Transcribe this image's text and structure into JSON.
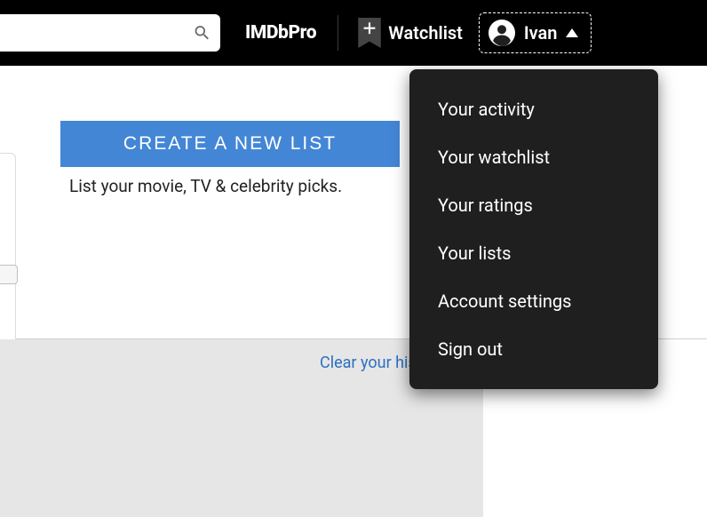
{
  "topbar": {
    "pro_label": "IMDbPro",
    "watchlist_label": "Watchlist",
    "user_name": "Ivan",
    "search_placeholder": ""
  },
  "content": {
    "create_button_label": "CREATE A NEW LIST",
    "subline": "List your movie, TV & celebrity picks."
  },
  "lower": {
    "clear_link": "Clear your his"
  },
  "dropdown": {
    "items": [
      "Your activity",
      "Your watchlist",
      "Your ratings",
      "Your lists",
      "Account settings",
      "Sign out"
    ]
  }
}
